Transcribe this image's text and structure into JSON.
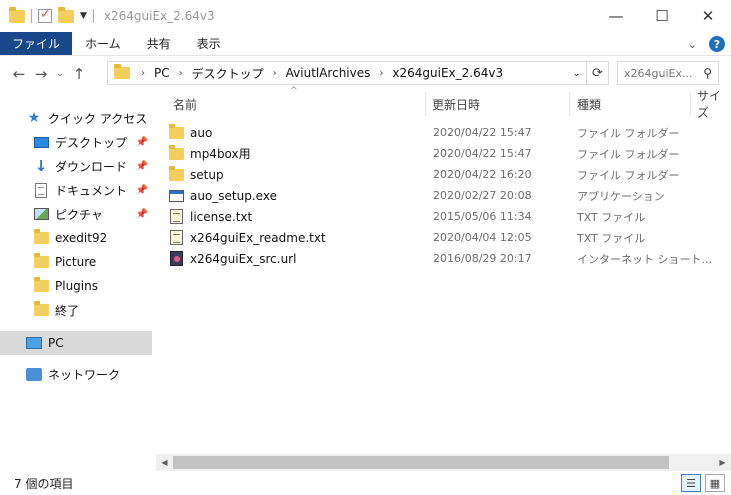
{
  "window": {
    "title": "x264guiEx_2.64v3",
    "minimize": "—",
    "maximize": "☐",
    "close": "✕"
  },
  "ribbon": {
    "tabs": [
      "ファイル",
      "ホーム",
      "共有",
      "表示"
    ],
    "collapse": "⌄",
    "help": "?"
  },
  "navbar": {
    "back": "←",
    "forward": "→",
    "recent": "⌄",
    "up": "↑",
    "breadcrumb": [
      "PC",
      "デスクトップ",
      "AviutlArchives",
      "x264guiEx_2.64v3"
    ],
    "search_placeholder": "x264guiEx..."
  },
  "sidebar": {
    "items": [
      {
        "label": "クイック アクセス",
        "icon": "star-icon"
      },
      {
        "label": "デスクトップ",
        "icon": "desktop-icon",
        "pinned": true
      },
      {
        "label": "ダウンロード",
        "icon": "download-icon",
        "pinned": true
      },
      {
        "label": "ドキュメント",
        "icon": "document-icon",
        "pinned": true
      },
      {
        "label": "ピクチャ",
        "icon": "picture-icon",
        "pinned": true
      },
      {
        "label": "exedit92",
        "icon": "folder-icon"
      },
      {
        "label": "Picture",
        "icon": "folder-icon"
      },
      {
        "label": "Plugins",
        "icon": "folder-icon"
      },
      {
        "label": "終了",
        "icon": "folder-icon"
      },
      {
        "label": "PC",
        "icon": "pc-icon",
        "selected": true
      },
      {
        "label": "ネットワーク",
        "icon": "network-icon"
      }
    ]
  },
  "columns": {
    "name": "名前",
    "date": "更新日時",
    "type": "種類",
    "size": "サイズ"
  },
  "files": [
    {
      "name": "auo",
      "date": "2020/04/22 15:47",
      "type": "ファイル フォルダー",
      "icon": "folder-icon"
    },
    {
      "name": "mp4box用",
      "date": "2020/04/22 15:47",
      "type": "ファイル フォルダー",
      "icon": "folder-icon"
    },
    {
      "name": "setup",
      "date": "2020/04/22 16:20",
      "type": "ファイル フォルダー",
      "icon": "folder-icon"
    },
    {
      "name": "auo_setup.exe",
      "date": "2020/02/27 20:08",
      "type": "アプリケーション",
      "icon": "exe-icon"
    },
    {
      "name": "license.txt",
      "date": "2015/05/06 11:34",
      "type": "TXT ファイル",
      "icon": "text-file-icon"
    },
    {
      "name": "x264guiEx_readme.txt",
      "date": "2020/04/04 12:05",
      "type": "TXT ファイル",
      "icon": "text-file-icon"
    },
    {
      "name": "x264guiEx_src.url",
      "date": "2016/08/29 20:17",
      "type": "インターネット ショート...",
      "icon": "url-icon"
    }
  ],
  "status": {
    "item_count": "7 個の項目"
  },
  "colors": {
    "file_tab": "#19478a",
    "selected_nav": "#d9d9d9",
    "folder": "#f4cf5d",
    "accent": "#2d89e0"
  }
}
